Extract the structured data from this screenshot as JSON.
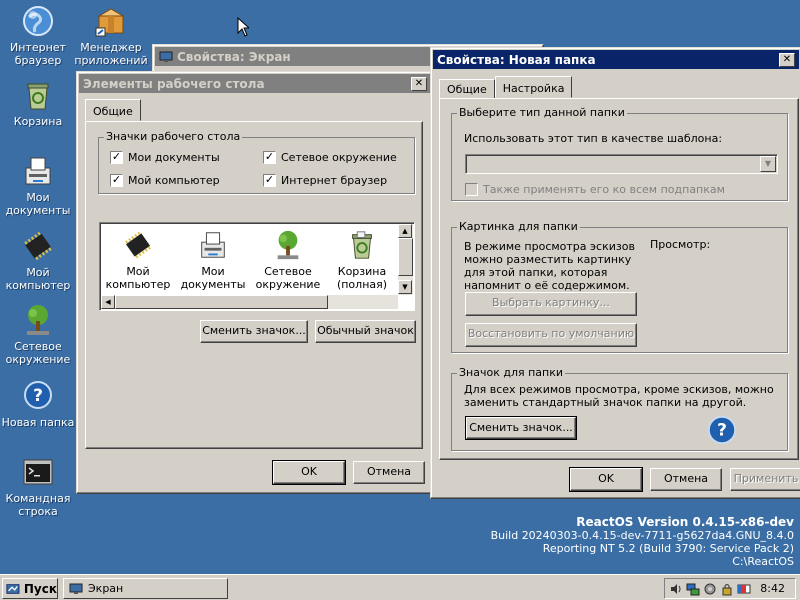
{
  "desktop": {
    "icons": [
      {
        "label": "Интернет\nбраузер",
        "icon": "globe-icon"
      },
      {
        "label": "Менеджер\nприложений",
        "icon": "package-icon"
      },
      {
        "label": "Корзина",
        "icon": "recycle-bin-icon"
      },
      {
        "label": "Мои\nдокументы",
        "icon": "documents-icon"
      },
      {
        "label": "Мой\nкомпьютер",
        "icon": "computer-chip-icon"
      },
      {
        "label": "Сетевое\nокружение",
        "icon": "network-tree-icon"
      },
      {
        "label": "Новая папка",
        "icon": "help-question-icon"
      },
      {
        "label": "Командная\nстрока",
        "icon": "terminal-icon"
      }
    ],
    "watermark": {
      "line1": "ReactOS Version 0.4.15-x86-dev",
      "line2": "Build 20240303-0.4.15-dev-7711-g5627da4.GNU_8.4.0",
      "line3": "Reporting NT 5.2 (Build 3790: Service Pack 2)",
      "line4": "C:\\ReactOS"
    }
  },
  "display_window": {
    "title": "Свойства: Экран",
    "ok": "OK",
    "cancel": "Отмена"
  },
  "desktop_items_dialog": {
    "title": "Элементы рабочего стола",
    "close": "✕",
    "tab_general": "Общие",
    "group_title": "Значки рабочего стола",
    "checkboxes": {
      "my_documents": "Мои документы",
      "network": "Сетевое окружение",
      "my_computer": "Мой компьютер",
      "browser": "Интернет браузер"
    },
    "list_items": [
      {
        "label": "Мой\nкомпьютер",
        "icon": "computer-chip-icon"
      },
      {
        "label": "Мои\nдокументы",
        "icon": "documents-icon"
      },
      {
        "label": "Сетевое\nокружение",
        "icon": "network-tree-icon"
      },
      {
        "label": "Корзина\n(полная)",
        "icon": "recycle-bin-full-icon"
      }
    ],
    "change_icon": "Сменить значок...",
    "default_icon": "Обычный значок"
  },
  "folder_props": {
    "title": "Свойства: Новая папка",
    "close": "✕",
    "tab_general": "Общие",
    "tab_customize": "Настройка",
    "folder_type": {
      "group_title": "Выберите тип данной папки",
      "label": "Использовать этот тип в качестве шаблона:",
      "selected": "",
      "also_apply": "Также применять его ко всем подпапкам"
    },
    "folder_picture": {
      "group_title": "Картинка для папки",
      "description": "В режиме просмотра эскизов можно разместить картинку для этой папки, которая напомнит о её содержимом.",
      "preview_label": "Просмотр:",
      "choose_picture": "Выбрать картинку...",
      "restore_default": "Восстановить по умолчанию"
    },
    "folder_icon": {
      "group_title": "Значок для папки",
      "description": "Для всех режимов просмотра, кроме эскизов, можно заменить стандартный значок папки на другой.",
      "change_icon": "Сменить значок..."
    },
    "ok": "OK",
    "cancel": "Отмена",
    "apply": "Применить"
  },
  "taskbar": {
    "start": "Пуск",
    "task": "Экран",
    "clock": "8:42"
  }
}
